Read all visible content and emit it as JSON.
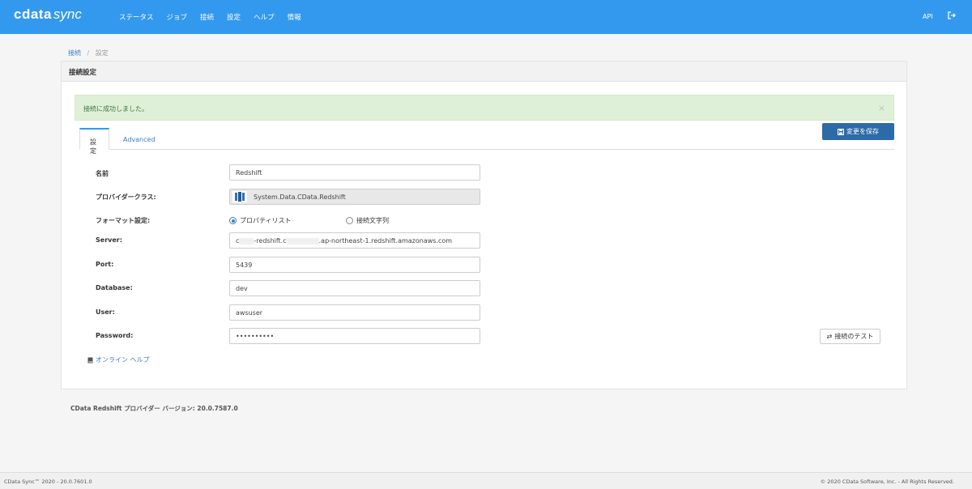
{
  "app": {
    "logo_main": "cdata",
    "logo_sub": "sync"
  },
  "nav": {
    "items": [
      "ステータス",
      "ジョブ",
      "接続",
      "設定",
      "ヘルプ",
      "情報"
    ],
    "api_label": "API"
  },
  "breadcrumb": {
    "parent": "接続",
    "separator": "/",
    "current": "設定"
  },
  "card": {
    "title": "接続設定"
  },
  "alert": {
    "message": "接続に成功しました。",
    "close": "×"
  },
  "toolbar": {
    "save_label": "変更を保存"
  },
  "tabs": [
    {
      "label": "設定",
      "active": true
    },
    {
      "label": "Advanced",
      "active": false
    }
  ],
  "form": {
    "name_label": "名前",
    "name_value": "Redshift",
    "provider_label": "プロバイダークラス:",
    "provider_value": "System.Data.CData.Redshift",
    "format_label": "フォーマット設定:",
    "format_option_props": "プロパティリスト",
    "format_option_conn": "接続文字列",
    "format_selected": "プロパティリスト",
    "server_label": "Server:",
    "server_value_start": "c",
    "server_value_mid": "-redshift.c",
    "server_value_end": ".ap-northeast-1.redshift.amazonaws.com",
    "port_label": "Port:",
    "port_value": "5439",
    "database_label": "Database:",
    "database_value": "dev",
    "user_label": "User:",
    "user_value": "awsuser",
    "password_label": "Password:",
    "password_value": "••••••••••"
  },
  "actions": {
    "test_label": "接続のテスト",
    "help_label": "オンライン ヘルプ"
  },
  "provider_version": "CData Redshift プロバイダー バージョン: 20.0.7587.0",
  "footer": {
    "left": "CData Sync™ 2020 - 20.0.7601.0",
    "right": "© 2020 CData Software, Inc. - All Rights Reserved."
  },
  "colors": {
    "topbar": "#3399ee",
    "primary_button": "#2d6aa8",
    "success_bg": "#dff0d8",
    "link": "#3a7fc1"
  }
}
